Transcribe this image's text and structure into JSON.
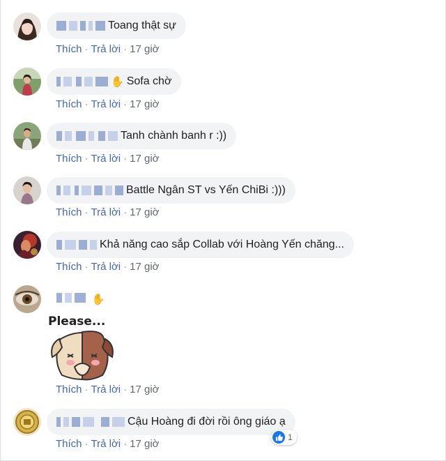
{
  "colors": {
    "link": "#4267b2",
    "bubble": "#f2f3f5",
    "meta": "#606770",
    "like": "#1877f2"
  },
  "actions": {
    "like": "Thích",
    "reply": "Trả lời",
    "dot": "·"
  },
  "comments": [
    {
      "text": "Toang thật sự",
      "time": "17 giờ",
      "avatar": "avatar-girl"
    },
    {
      "text": "Sofa chờ",
      "time": "17 giờ",
      "avatar": "avatar-woman-outdoor",
      "icon": "waving-hand-icon"
    },
    {
      "text": "Tanh chành banh r :))",
      "time": "17 giờ",
      "avatar": "avatar-man-outdoor"
    },
    {
      "text": "Battle Ngân ST vs Yến ChiBi :)))",
      "time": "17 giờ",
      "avatar": "avatar-young-man"
    },
    {
      "text": "Khả năng cao sắp Collab với Hoàng Yến chăng...",
      "time": "17 giờ",
      "avatar": "avatar-character-art"
    },
    {
      "text": "",
      "time": "17 giờ",
      "avatar": "avatar-eye-closeup",
      "icon": "waving-hand-icon",
      "sticker": "Please..."
    },
    {
      "text": "Cậu Hoàng đi đời rồi ông giáo ạ",
      "time": "17 giờ",
      "avatar": "avatar-gold-emblem",
      "reaction_count": "1"
    }
  ]
}
